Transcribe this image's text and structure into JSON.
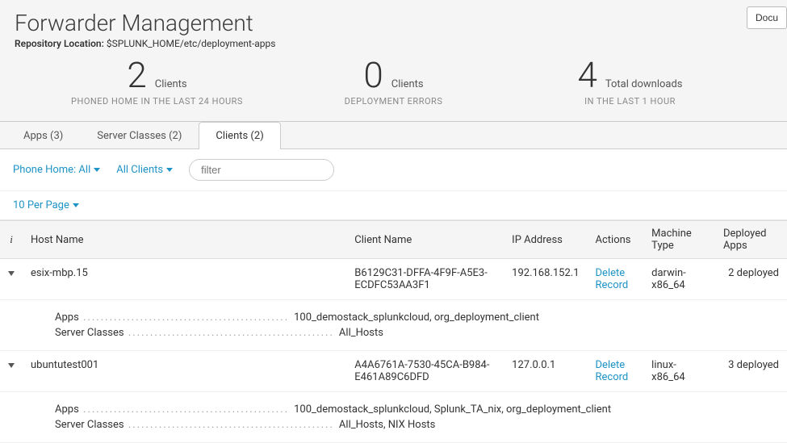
{
  "header": {
    "title": "Forwarder Management",
    "repo_label": "Repository Location:",
    "repo_value": "$SPLUNK_HOME/etc/deployment-apps",
    "docu_btn": "Docu"
  },
  "stats": [
    {
      "num": "2",
      "small": "Clients",
      "sub": "PHONED HOME IN THE LAST 24 HOURS"
    },
    {
      "num": "0",
      "small": "Clients",
      "sub": "DEPLOYMENT ERRORS"
    },
    {
      "num": "4",
      "small": "Total downloads",
      "sub": "IN THE LAST 1 HOUR"
    }
  ],
  "tabs": [
    {
      "label": "Apps (3)",
      "active": false
    },
    {
      "label": "Server Classes (2)",
      "active": false
    },
    {
      "label": "Clients (2)",
      "active": true
    }
  ],
  "filters": {
    "phone_home": "Phone Home: All",
    "all_clients": "All Clients",
    "filter_placeholder": "filter",
    "per_page": "10 Per Page"
  },
  "columns": {
    "info": "i",
    "host": "Host Name",
    "client": "Client Name",
    "ip": "IP Address",
    "actions": "Actions",
    "machine": "Machine Type",
    "deployed": "Deployed Apps"
  },
  "rows": [
    {
      "host": "esix-mbp.15",
      "client": "B6129C31-DFFA-4F9F-A5E3-ECDFC53AA3F1",
      "ip": "192.168.152.1",
      "action": "Delete Record",
      "machine": "darwin-x86_64",
      "deployed": "2 deployed",
      "apps_label": "Apps",
      "apps_value": "100_demostack_splunkcloud, org_deployment_client",
      "sc_label": "Server Classes",
      "sc_value": "All_Hosts"
    },
    {
      "host": "ubuntutest001",
      "client": "A4A6761A-7530-45CA-B984-E461A89C6DFD",
      "ip": "127.0.0.1",
      "action": "Delete Record",
      "machine": "linux-x86_64",
      "deployed": "3 deployed",
      "apps_label": "Apps",
      "apps_value": "100_demostack_splunkcloud, Splunk_TA_nix, org_deployment_client",
      "sc_label": "Server Classes",
      "sc_value": "All_Hosts, NIX Hosts"
    }
  ]
}
